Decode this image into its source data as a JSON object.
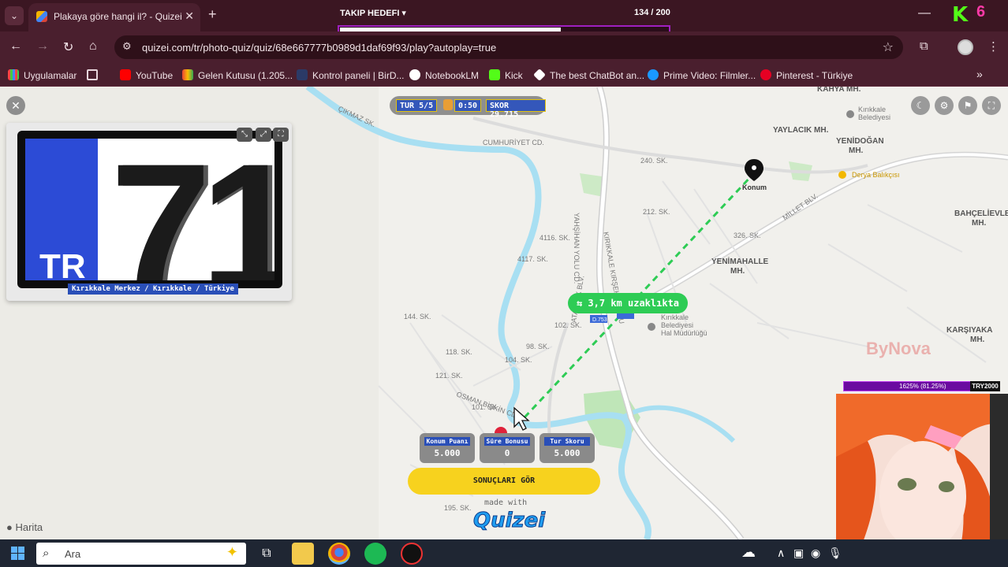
{
  "browser": {
    "tab_title": "Plakaya göre hangi il? - Quizei",
    "url": "quizei.com/tr/photo-quiz/quiz/68e667777b0989d1daf69f93/play?autoplay=true",
    "bookmarks": [
      {
        "label": "Uygulamalar"
      },
      {
        "label": "YouTube"
      },
      {
        "label": "Gelen Kutusu (1.205..."
      },
      {
        "label": "Kontrol paneli | BirD..."
      },
      {
        "label": "NotebookLM"
      },
      {
        "label": "Kick"
      },
      {
        "label": "The best ChatBot an..."
      },
      {
        "label": "Prime Video: Filmler..."
      },
      {
        "label": "Pinterest - Türkiye"
      }
    ]
  },
  "stream_overlay": {
    "goal_title": "TAKIP HEDEFI ▾",
    "goal_count": "134 / 200",
    "goal_progress": 0.67,
    "k_num": "6",
    "sub_bar_text": "1625% (81.25%)",
    "sub_tag": "TRY2000"
  },
  "quiz": {
    "tur": "TUR 5/5",
    "timer": "0:50",
    "score": "SKOR 29.715",
    "caption": "Kırıkkale Merkez / Kırıkkale / Türkiye",
    "plate_country": "TR",
    "plate_number": "71",
    "distance": "⇆ 3,7 km uzaklıkta",
    "marker_label": "Konum",
    "results": [
      {
        "label": "Konum Puanı",
        "value": "5.000"
      },
      {
        "label": "Süre Bonusu",
        "value": "0"
      },
      {
        "label": "Tur Skoru",
        "value": "5.000"
      }
    ],
    "results_button": "SONUÇLARI GÖR",
    "made_with": "made with",
    "brand": "Quizei",
    "map_attribution": "Harita"
  },
  "map_labels": {
    "districts": [
      {
        "text": "KAHYA MH."
      },
      {
        "text": "YAYLACIK MH."
      },
      {
        "text": "YENİDOĞAN"
      },
      {
        "text": "MH."
      },
      {
        "text": "BAHÇELİEVLER"
      },
      {
        "text": "MH."
      },
      {
        "text": "YENİMAHALLE"
      },
      {
        "text": "MH."
      },
      {
        "text": "KARŞIYAKA"
      },
      {
        "text": "MH."
      }
    ],
    "pois": [
      "Kırıkkale Belediyesi",
      "Derya Balıkçısı",
      "Kırıkkale Belediyesi Hal Müdürlüğü"
    ],
    "streets": [
      "CUMHURİYET CD.",
      "ÇIKMAZ SK.",
      "YAHŞİHAN YOLU CD.",
      "KIRIKKALE KIRŞEHİR YOLU",
      "ATATÜRK BLV.",
      "MİLLET BLV.",
      "OSMAN BİŞKİN CD.",
      "4116. SK.",
      "4117. SK.",
      "102. SK.",
      "98. SK.",
      "104. SK.",
      "121. SK.",
      "118. SK.",
      "101. SK.",
      "144. SK.",
      "212. SK.",
      "240. SK.",
      "326. SK.",
      "195. SK."
    ],
    "roads": [
      "D.753"
    ],
    "watermark": "ByNova"
  },
  "taskbar": {
    "search_placeholder": "Ara"
  },
  "colors": {
    "route": "#2ecc55",
    "river": "#a8dff2",
    "accent_button": "#f7d21e",
    "chip_blue": "#2a4fb8"
  }
}
